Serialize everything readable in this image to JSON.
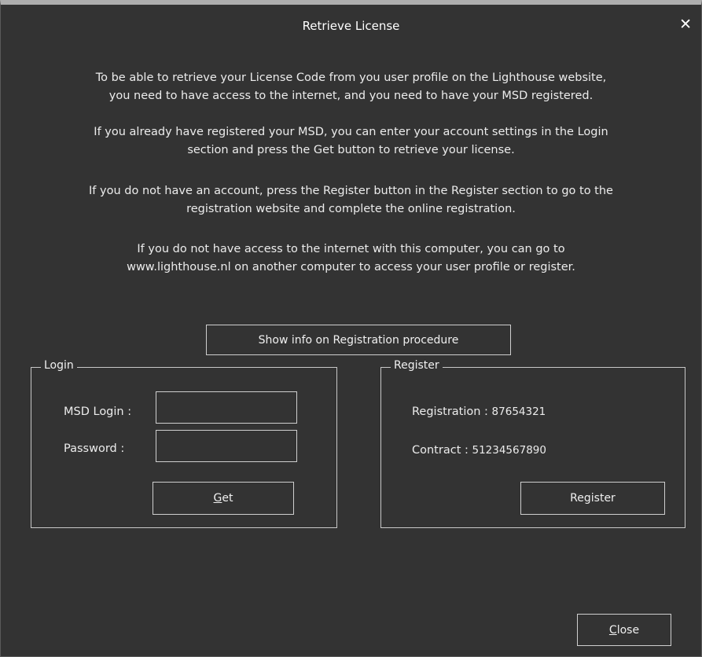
{
  "window": {
    "title": "Retrieve License",
    "close_glyph": "✕"
  },
  "intro": {
    "p1_line1": "To be able to retrieve your License Code from you user profile on the Lighthouse website,",
    "p1_line2": "you need to have access to the internet, and you need to have your MSD registered.",
    "p2_line1": "If you already have registered your MSD, you can enter your account settings in the Login",
    "p2_line2": "section and press the Get button to retrieve your license.",
    "p3_line1": "If you do not have an account, press the Register button in the Register section to go to the",
    "p3_line2": "registration website and complete the online registration.",
    "p4_line1": "If you do not have access to the internet with this computer, you can go to",
    "p4_line2": "www.lighthouse.nl on another computer to access your user profile or register."
  },
  "show_info_button": "Show info on Registration procedure",
  "login": {
    "legend": "Login",
    "msd_login_label": "MSD Login :",
    "msd_login_value": "",
    "password_label": "Password :",
    "password_value": "",
    "get_button_mnemonic": "G",
    "get_button_rest": "et"
  },
  "register": {
    "legend": "Register",
    "registration_label": "Registration : ",
    "registration_value": "87654321",
    "contract_label": "Contract : ",
    "contract_value": "51234567890",
    "register_button": "Register"
  },
  "close_button_mnemonic": "C",
  "close_button_rest": "lose"
}
